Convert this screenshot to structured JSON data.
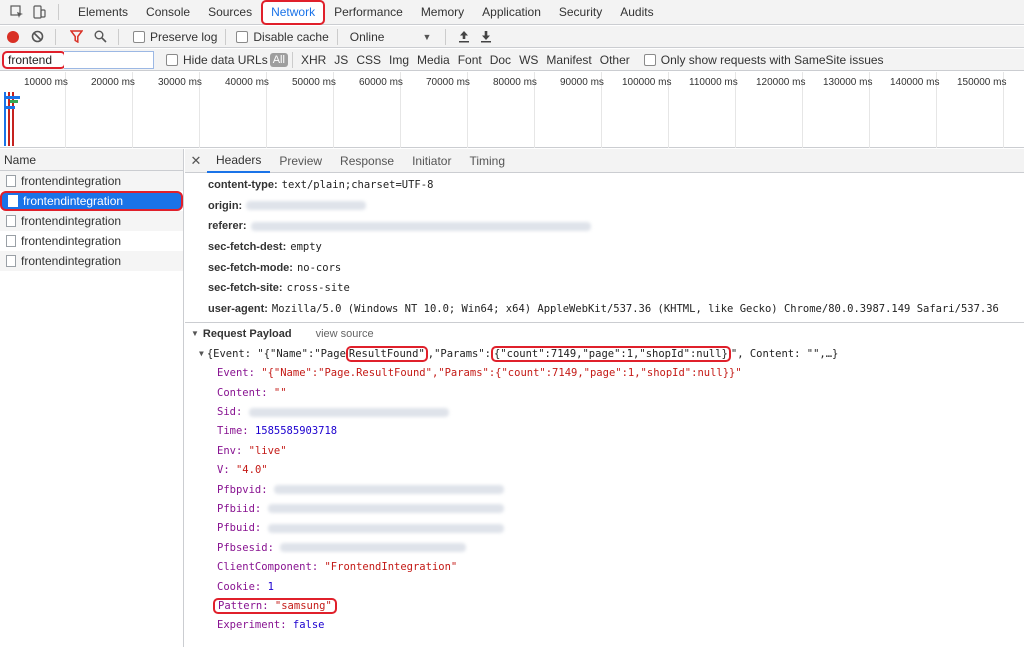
{
  "devtools": {
    "tabs": [
      "Elements",
      "Console",
      "Sources",
      "Network",
      "Performance",
      "Memory",
      "Application",
      "Security",
      "Audits"
    ]
  },
  "toolbar": {
    "preserve_log": "Preserve log",
    "disable_cache": "Disable cache",
    "throttle": "Online"
  },
  "filter": {
    "value": "frontend",
    "hide_data_urls": "Hide data URLs",
    "all": "All",
    "types": [
      "XHR",
      "JS",
      "CSS",
      "Img",
      "Media",
      "Font",
      "Doc",
      "WS",
      "Manifest",
      "Other"
    ],
    "samesite": "Only show requests with SameSite issues"
  },
  "overview": {
    "ticks": [
      "10000 ms",
      "20000 ms",
      "30000 ms",
      "40000 ms",
      "50000 ms",
      "60000 ms",
      "70000 ms",
      "80000 ms",
      "90000 ms",
      "100000 ms",
      "110000 ms",
      "120000 ms",
      "130000 ms",
      "140000 ms",
      "150000 ms"
    ]
  },
  "requests": {
    "header": "Name",
    "items": [
      "frontendintegration",
      "frontendintegration",
      "frontendintegration",
      "frontendintegration",
      "frontendintegration"
    ],
    "selected_index": 1
  },
  "details": {
    "tabs": [
      "Headers",
      "Preview",
      "Response",
      "Initiator",
      "Timing"
    ],
    "headers": [
      {
        "k": "content-type:",
        "v": "text/plain;charset=UTF-8"
      },
      {
        "k": "origin:",
        "v": ""
      },
      {
        "k": "referer:",
        "v": ""
      },
      {
        "k": "sec-fetch-dest:",
        "v": "empty"
      },
      {
        "k": "sec-fetch-mode:",
        "v": "no-cors"
      },
      {
        "k": "sec-fetch-site:",
        "v": "cross-site"
      },
      {
        "k": "user-agent:",
        "v": "Mozilla/5.0 (Windows NT 10.0; Win64; x64) AppleWebKit/537.36 (KHTML, like Gecko) Chrome/80.0.3987.149 Safari/537.36"
      }
    ],
    "payload_title": "Request Payload",
    "view_source": "view source",
    "summary": {
      "p1": "{Event: \"{\"Name\":\"Page",
      "p2": "ResultFound\"",
      "p3": ",\"Params\":",
      "p4": "{\"count\":7149,\"page\":1,\"shopId\":null}",
      "p5": "\", Content: \"\",…}"
    },
    "payload": {
      "event_k": "Event:",
      "event_v": "\"{\"Name\":\"Page.ResultFound\",\"Params\":{\"count\":7149,\"page\":1,\"shopId\":null}}\"",
      "content_k": "Content:",
      "content_v": "\"\"",
      "sid_k": "Sid:",
      "time_k": "Time:",
      "time_v": "1585585903718",
      "env_k": "Env:",
      "env_v": "\"live\"",
      "v_k": "V:",
      "v_v": "\"4.0\"",
      "pfbpvid_k": "Pfbpvid:",
      "pfbiid_k": "Pfbiid:",
      "pfbuid_k": "Pfbuid:",
      "pfbsesid_k": "Pfbsesid:",
      "cc_k": "ClientComponent:",
      "cc_v": "\"FrontendIntegration\"",
      "cookie_k": "Cookie:",
      "cookie_v": "1",
      "pattern_k": "Pattern:",
      "pattern_v": "\"samsung\"",
      "exp_k": "Experiment:",
      "exp_v": "false"
    }
  }
}
